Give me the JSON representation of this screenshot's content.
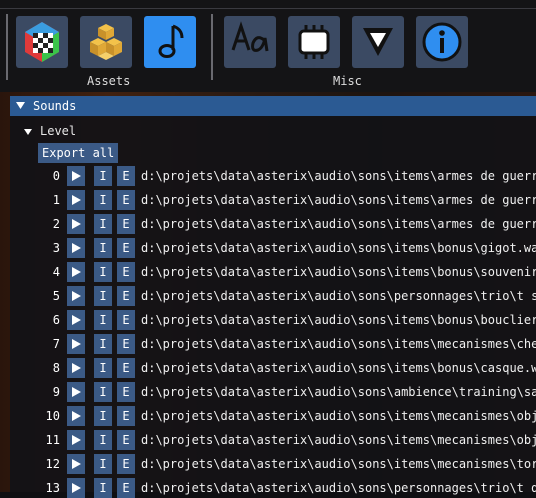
{
  "toolbar": {
    "groups": [
      {
        "label": "Assets"
      },
      {
        "label": "Misc"
      }
    ]
  },
  "window": {
    "title": "Sounds",
    "tree_node": "Level",
    "export_label": "Export all",
    "row_buttons": {
      "play_icon": "play-icon",
      "i_label": "I",
      "e_label": "E"
    },
    "rows": [
      {
        "index": "0",
        "path": "d:\\projets\\data\\asterix\\audio\\sons\\items\\armes de guerre\\"
      },
      {
        "index": "1",
        "path": "d:\\projets\\data\\asterix\\audio\\sons\\items\\armes de guerre\\"
      },
      {
        "index": "2",
        "path": "d:\\projets\\data\\asterix\\audio\\sons\\items\\armes de guerre\\"
      },
      {
        "index": "3",
        "path": "d:\\projets\\data\\asterix\\audio\\sons\\items\\bonus\\gigot.wav"
      },
      {
        "index": "4",
        "path": "d:\\projets\\data\\asterix\\audio\\sons\\items\\bonus\\souvenir.w"
      },
      {
        "index": "5",
        "path": "d:\\projets\\data\\asterix\\audio\\sons\\personnages\\trio\\t sa"
      },
      {
        "index": "6",
        "path": "d:\\projets\\data\\asterix\\audio\\sons\\items\\bonus\\bouclier.w"
      },
      {
        "index": "7",
        "path": "d:\\projets\\data\\asterix\\audio\\sons\\items\\mecanismes\\check"
      },
      {
        "index": "8",
        "path": "d:\\projets\\data\\asterix\\audio\\sons\\items\\bonus\\casque.wav"
      },
      {
        "index": "9",
        "path": "d:\\projets\\data\\asterix\\audio\\sons\\ambience\\training\\samp"
      },
      {
        "index": "10",
        "path": "d:\\projets\\data\\asterix\\audio\\sons\\items\\mecanismes\\objet"
      },
      {
        "index": "11",
        "path": "d:\\projets\\data\\asterix\\audio\\sons\\items\\mecanismes\\objet"
      },
      {
        "index": "12",
        "path": "d:\\projets\\data\\asterix\\audio\\sons\\items\\mecanismes\\torch"
      },
      {
        "index": "13",
        "path": "d:\\projets\\data\\asterix\\audio\\sons\\personnages\\trio\\t de"
      }
    ]
  },
  "colors": {
    "button_bg": "#3b4a63",
    "active_button_bg": "#2f8ef0",
    "titlebar_bg": "#2b5a93",
    "row_button_bg": "#3b5a86"
  }
}
